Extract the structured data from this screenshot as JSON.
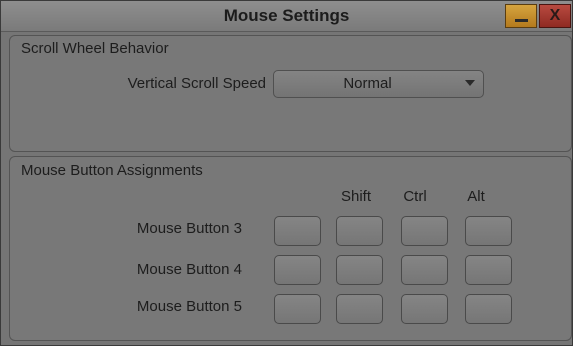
{
  "window": {
    "title": "Mouse Settings",
    "close_glyph": "X"
  },
  "scroll_group": {
    "title": "Scroll Wheel Behavior",
    "vertical_speed_label": "Vertical Scroll Speed",
    "vertical_speed_value": "Normal"
  },
  "buttons_group": {
    "title": "Mouse Button Assignments",
    "columns": [
      "",
      "Shift",
      "Ctrl",
      "Alt"
    ],
    "rows": [
      "Mouse Button 3",
      "Mouse Button 4",
      "Mouse Button 5"
    ]
  },
  "colors": {
    "background": "#757575",
    "minimize": "#c48f2e",
    "close": "#a23a31"
  }
}
